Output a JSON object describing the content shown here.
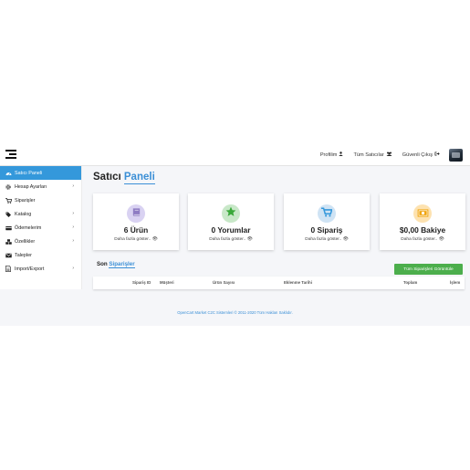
{
  "header": {
    "links": [
      {
        "label": "Profilim",
        "icon": "user-icon"
      },
      {
        "label": "Tüm Satıcılar",
        "icon": "users-icon"
      },
      {
        "label": "Güvenli Çıkış",
        "icon": "sign-out-icon"
      }
    ]
  },
  "sidebar": {
    "items": [
      {
        "label": "Satıcı Paneli",
        "icon": "dashboard-icon",
        "active": true,
        "has_submenu": false
      },
      {
        "label": "Hesap Ayarları",
        "icon": "gear-icon",
        "active": false,
        "has_submenu": true
      },
      {
        "label": "Siparişler",
        "icon": "cart-icon",
        "active": false,
        "has_submenu": false
      },
      {
        "label": "Katalog",
        "icon": "tags-icon",
        "active": false,
        "has_submenu": true
      },
      {
        "label": "Ödemelerim",
        "icon": "credit-card-icon",
        "active": false,
        "has_submenu": true
      },
      {
        "label": "Özellikler",
        "icon": "cubes-icon",
        "active": false,
        "has_submenu": true
      },
      {
        "label": "Talepler",
        "icon": "envelope-icon",
        "active": false,
        "has_submenu": false
      },
      {
        "label": "Import/Export",
        "icon": "file-icon",
        "active": false,
        "has_submenu": true
      }
    ]
  },
  "page": {
    "title_main": "Satıcı",
    "title_highlight": "Paneli"
  },
  "cards": [
    {
      "value": "6 Ürün",
      "more": "Daha fazla göster..",
      "icon": "book-icon",
      "color": "#8e7cc3",
      "bg": "#d9d2f2"
    },
    {
      "value": "0 Yorumlar",
      "more": "Daha fazla göster..",
      "icon": "star-icon",
      "color": "#39a839",
      "bg": "#c8e8c8"
    },
    {
      "value": "0 Sipariş",
      "more": "Daha fazla göster..",
      "icon": "cart-icon",
      "color": "#3498db",
      "bg": "#cfe3f4"
    },
    {
      "value": "$0,00 Bakiye",
      "more": "Daha fazla göster..",
      "icon": "money-icon",
      "color": "#f0a30a",
      "bg": "#fde2b0"
    }
  ],
  "recent_orders": {
    "title_main": "Son",
    "title_highlight": "Siparişler",
    "view_all_button": "Tüm Siparişleri Görüntüle",
    "columns": [
      "Sipariş ID",
      "Müşteri",
      "Ürün Sayısı",
      "Eklenme Tarihi",
      "Toplam",
      "İşlem"
    ]
  },
  "footer": {
    "text": "OpenCart Market C2C Sistemleri © 2011-2020 Tüm Hakları Saklıdır."
  },
  "colors": {
    "accent": "#3498db",
    "success": "#4cae4c"
  }
}
